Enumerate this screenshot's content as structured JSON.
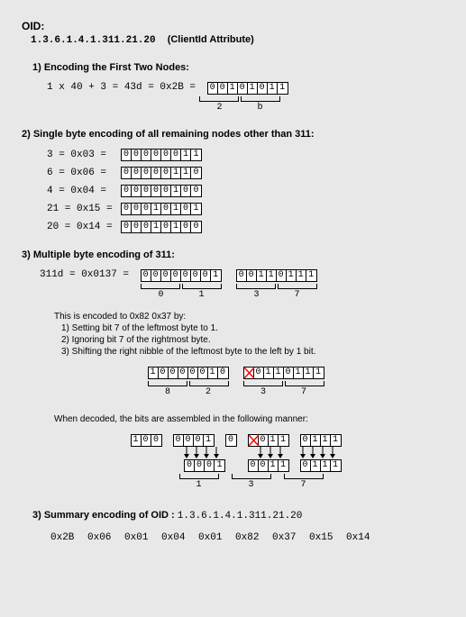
{
  "oid_label": "OID:",
  "oid_value": "1.3.6.1.4.1.311.21.20",
  "oid_attr": "(ClientId Attribute)",
  "s1": {
    "title": "1) Encoding the First Two Nodes:",
    "eq": "1 x 40 + 3 = 43d = 0x2B = ",
    "bits": [
      "0",
      "0",
      "1",
      "0",
      "1",
      "0",
      "1",
      "1"
    ],
    "nibs": [
      "2",
      "b"
    ]
  },
  "s2": {
    "title": "2) Single byte encoding of all remaining nodes other than 311:",
    "rows": [
      {
        "lbl": "3 = 0x03 =",
        "bits": [
          "0",
          "0",
          "0",
          "0",
          "0",
          "0",
          "1",
          "1"
        ]
      },
      {
        "lbl": "6 = 0x06 =",
        "bits": [
          "0",
          "0",
          "0",
          "0",
          "0",
          "1",
          "1",
          "0"
        ]
      },
      {
        "lbl": "4 = 0x04 =",
        "bits": [
          "0",
          "0",
          "0",
          "0",
          "0",
          "1",
          "0",
          "0"
        ]
      },
      {
        "lbl": "21 = 0x15 =",
        "bits": [
          "0",
          "0",
          "0",
          "1",
          "0",
          "1",
          "0",
          "1"
        ]
      },
      {
        "lbl": "20 = 0x14 =",
        "bits": [
          "0",
          "0",
          "0",
          "1",
          "0",
          "1",
          "0",
          "0"
        ]
      }
    ]
  },
  "s3": {
    "title": "3) Multiple byte encoding of 311:",
    "eq": "311d = 0x0137 = ",
    "b1": [
      "0",
      "0",
      "0",
      "0",
      "0",
      "0",
      "0",
      "1"
    ],
    "b2": [
      "0",
      "0",
      "1",
      "1",
      "0",
      "1",
      "1",
      "1"
    ],
    "nibs1": [
      "0",
      "1"
    ],
    "nibs2": [
      "3",
      "7"
    ],
    "explain_lead": "This is encoded to 0x82 0x37 by:",
    "explain": [
      "1) Setting bit 7 of the leftmost byte to 1.",
      "2) Ignoring bit 7 of the rightmost byte.",
      "3) Shifting the right nibble of the leftmost byte to the left by 1 bit."
    ],
    "enc_b1": [
      "1",
      "0",
      "0",
      "0",
      "0",
      "0",
      "1",
      "0"
    ],
    "enc_b2": [
      "X",
      "0",
      "1",
      "1",
      "0",
      "1",
      "1",
      "1"
    ],
    "enc_nibs1": [
      "8",
      "2"
    ],
    "enc_nibs2": [
      "3",
      "7"
    ],
    "decode_text": "When decoded, the bits are assembled in the following manner:",
    "dec_top_a": [
      "1",
      "0",
      "0"
    ],
    "dec_top_b": [
      "0",
      "0",
      "0",
      "1"
    ],
    "dec_top_b_end": [
      "0"
    ],
    "dec_top_c": [
      "X",
      "0",
      "1",
      "1"
    ],
    "dec_top_d": [
      "0",
      "1",
      "1",
      "1"
    ],
    "dec_bot_b": [
      "0",
      "0",
      "0",
      "1"
    ],
    "dec_bot_c": [
      "0",
      "0",
      "1",
      "1"
    ],
    "dec_bot_d": [
      "0",
      "1",
      "1",
      "1"
    ],
    "dec_nibs": [
      "1",
      "3",
      "7"
    ]
  },
  "s4": {
    "title_pre": "3) Summary encoding of OID : ",
    "oid": "1.3.6.1.4.1.311.21.20",
    "bytes": "0x2B 0x06 0x01 0x04 0x01 0x82 0x37 0x15 0x14"
  }
}
